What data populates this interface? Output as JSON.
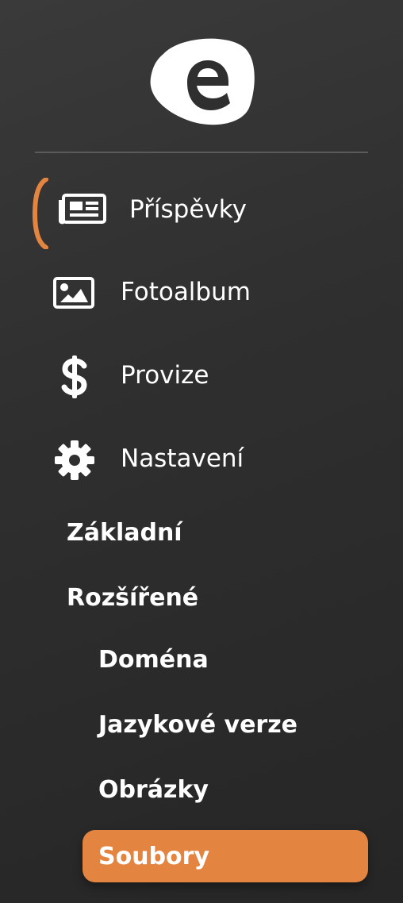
{
  "brand": {
    "logo_icon": "e-logo-blob",
    "accent_color": "#e38440"
  },
  "nav": {
    "items": [
      {
        "label": "Příspěvky",
        "icon": "newspaper-icon",
        "active": true
      },
      {
        "label": "Fotoalbum",
        "icon": "image-icon",
        "active": false
      },
      {
        "label": "Provize",
        "icon": "dollar-icon",
        "active": false
      },
      {
        "label": "Nastavení",
        "icon": "gear-icon",
        "active": false
      }
    ]
  },
  "settings_sub": {
    "zakladni": "Základní",
    "rozsirene": "Rozšířené",
    "domena": "Doména",
    "jazykove_verze": "Jazykové verze",
    "obrazky": "Obrázky",
    "soubory": "Soubory"
  }
}
